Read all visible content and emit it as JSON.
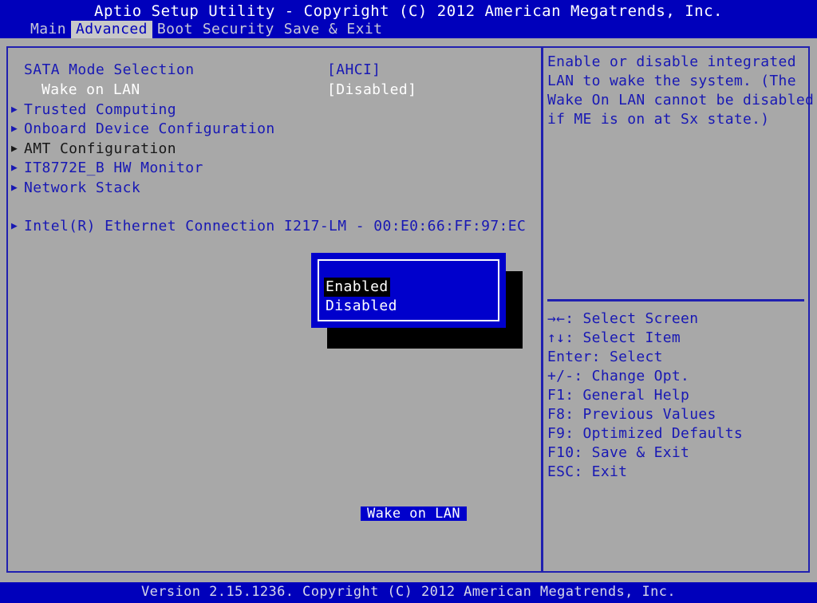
{
  "header": {
    "title": "Aptio Setup Utility - Copyright (C) 2012 American Megatrends, Inc.",
    "tabs": [
      {
        "label": "Main",
        "active": false
      },
      {
        "label": "Advanced",
        "active": true
      },
      {
        "label": "Boot",
        "active": false
      },
      {
        "label": "Security",
        "active": false
      },
      {
        "label": "Save & Exit",
        "active": false
      }
    ]
  },
  "settings": [
    {
      "arrow": "",
      "label": "SATA Mode Selection",
      "value": "[AHCI]",
      "indent": 0,
      "color": "blue",
      "value_color": "blue"
    },
    {
      "arrow": "",
      "label": "Wake on LAN",
      "value": "[Disabled]",
      "indent": 1,
      "color": "white",
      "value_color": "white"
    },
    {
      "arrow": "▶",
      "label": "Trusted Computing",
      "value": "",
      "indent": 0,
      "color": "blue",
      "value_color": "blue"
    },
    {
      "arrow": "▶",
      "label": "Onboard Device Configuration",
      "value": "",
      "indent": 0,
      "color": "blue",
      "value_color": "blue"
    },
    {
      "arrow": "▶",
      "label": "AMT Configuration",
      "value": "",
      "indent": 0,
      "color": "dark",
      "value_color": "dark"
    },
    {
      "arrow": "▶",
      "label": "IT8772E_B HW Monitor",
      "value": "",
      "indent": 0,
      "color": "blue",
      "value_color": "blue"
    },
    {
      "arrow": "▶",
      "label": "Network Stack",
      "value": "",
      "indent": 0,
      "color": "blue",
      "value_color": "blue"
    },
    {
      "arrow": "▶",
      "label": "Intel(R) Ethernet Connection I217-LM - 00:E0:66:FF:97:EC",
      "value": "",
      "indent": 0,
      "color": "blue",
      "value_color": "blue"
    }
  ],
  "help": {
    "lines": [
      "Enable or disable integrated",
      "LAN to wake the system. (The",
      "Wake On LAN cannot be disabled",
      "if ME is on at Sx state.)"
    ]
  },
  "legend": {
    "lines": [
      "→←: Select Screen",
      "↑↓: Select Item",
      "Enter: Select",
      "+/-: Change Opt.",
      "F1: General Help",
      "F8: Previous Values",
      "F9: Optimized Defaults",
      "F10: Save & Exit",
      "ESC: Exit"
    ]
  },
  "dialog": {
    "title": "Wake on LAN",
    "options": [
      {
        "label": "Enabled",
        "selected": true
      },
      {
        "label": "Disabled",
        "selected": false
      }
    ]
  },
  "footer": {
    "text": "Version 2.15.1236. Copyright (C) 2012 American Megatrends, Inc."
  },
  "colors": {
    "header_blue": "#0000bb",
    "text_blue": "#1818b4",
    "panel_gray": "#a8a8a8",
    "dialog_blue": "#0000cc",
    "border_blue": "#2020b0",
    "highlight_black": "#000000",
    "selected_white": "#ffffff"
  }
}
